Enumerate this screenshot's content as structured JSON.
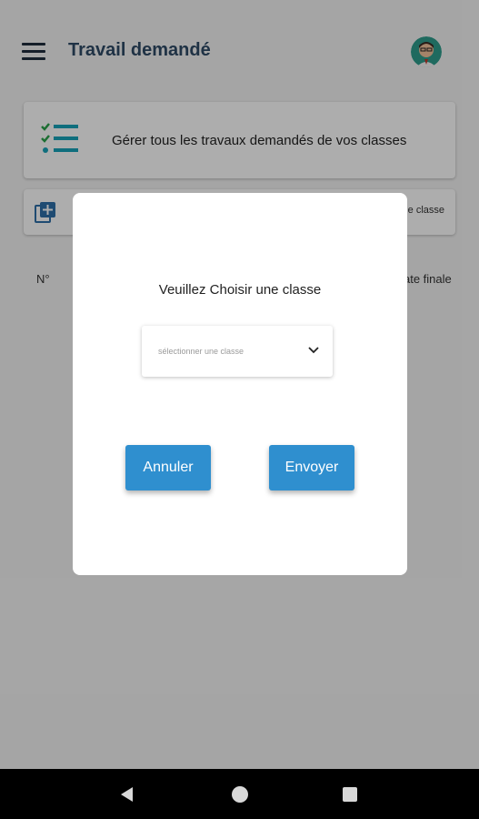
{
  "appbar": {
    "title": "Travail demandé"
  },
  "cards": {
    "manage_text": "Gérer tous les travaux demandés de vos classes",
    "add_text_partial": "une classe"
  },
  "table": {
    "col_number": "N°",
    "col_date_partial": "ate finale"
  },
  "dialog": {
    "title": "Veuillez Choisir une classe",
    "select_placeholder": "sélectionner une classe",
    "cancel_label": "Annuler",
    "send_label": "Envoyer"
  },
  "colors": {
    "accent": "#2f8fcf",
    "title": "#2f4a66",
    "teal_icon": "#17a2b8"
  }
}
